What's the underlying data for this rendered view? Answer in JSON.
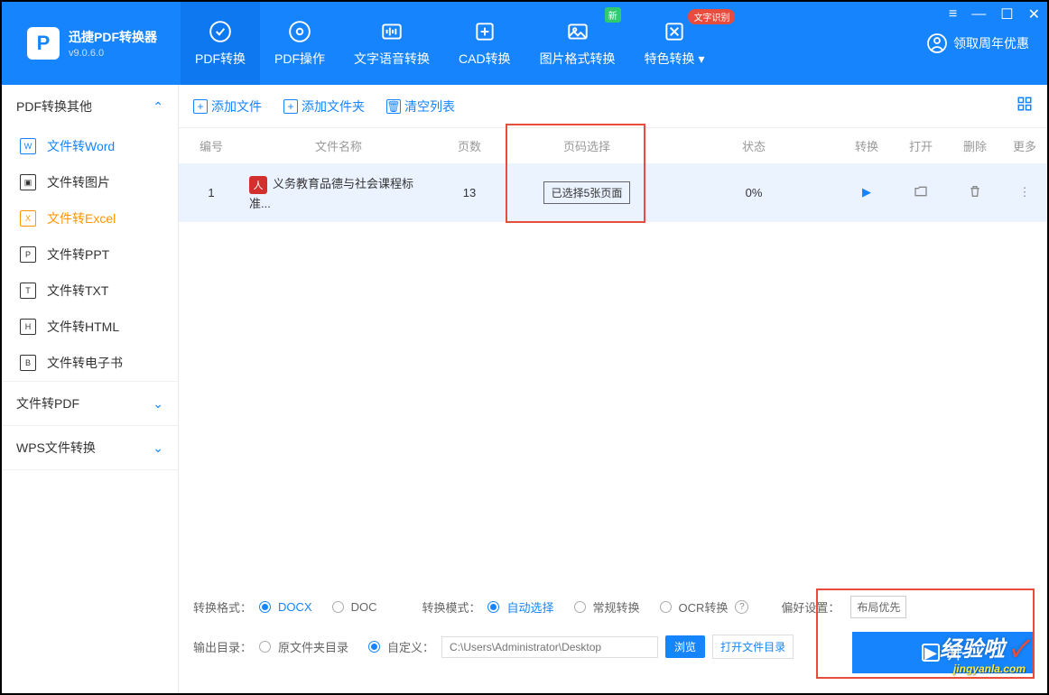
{
  "app": {
    "name": "迅捷PDF转换器",
    "version": "v9.0.6.0"
  },
  "topTabs": [
    {
      "label": "PDF转换"
    },
    {
      "label": "PDF操作"
    },
    {
      "label": "文字语音转换"
    },
    {
      "label": "CAD转换"
    },
    {
      "label": "图片格式转换",
      "badge_new": "新"
    },
    {
      "label": "特色转换",
      "badge_ocr": "文字识别"
    }
  ],
  "promo": "领取周年优惠",
  "sidebar": {
    "sec1": {
      "title": "PDF转换其他",
      "items": [
        {
          "label": "文件转Word",
          "glyph": "W"
        },
        {
          "label": "文件转图片",
          "glyph": "▣"
        },
        {
          "label": "文件转Excel",
          "glyph": "X"
        },
        {
          "label": "文件转PPT",
          "glyph": "P"
        },
        {
          "label": "文件转TXT",
          "glyph": "T"
        },
        {
          "label": "文件转HTML",
          "glyph": "H"
        },
        {
          "label": "文件转电子书",
          "glyph": "B"
        }
      ]
    },
    "sec2": {
      "title": "文件转PDF"
    },
    "sec3": {
      "title": "WPS文件转换"
    }
  },
  "toolbar": {
    "add_file": "添加文件",
    "add_folder": "添加文件夹",
    "clear": "清空列表"
  },
  "columns": {
    "num": "编号",
    "name": "文件名称",
    "pages": "页数",
    "select": "页码选择",
    "status": "状态",
    "convert": "转换",
    "open": "打开",
    "delete": "删除",
    "more": "更多"
  },
  "row": {
    "num": "1",
    "name": "义务教育品德与社会课程标准...",
    "pages": "13",
    "select_label": "已选择5张页面",
    "status": "0%"
  },
  "options": {
    "format_label": "转换格式：",
    "format_docx": "DOCX",
    "format_doc": "DOC",
    "mode_label": "转换模式：",
    "mode_auto": "自动选择",
    "mode_normal": "常规转换",
    "mode_ocr": "OCR转换",
    "pref_label": "偏好设置：",
    "pref_value": "布局优先",
    "output_label": "输出目录：",
    "output_orig": "原文件夹目录",
    "output_custom": "自定义：",
    "path": "C:\\Users\\Administrator\\Desktop",
    "browse": "浏览",
    "open_dir": "打开文件目录"
  },
  "start_btn": "开",
  "watermark": {
    "top": "经验啦",
    "bot": "jingyanla.com"
  }
}
